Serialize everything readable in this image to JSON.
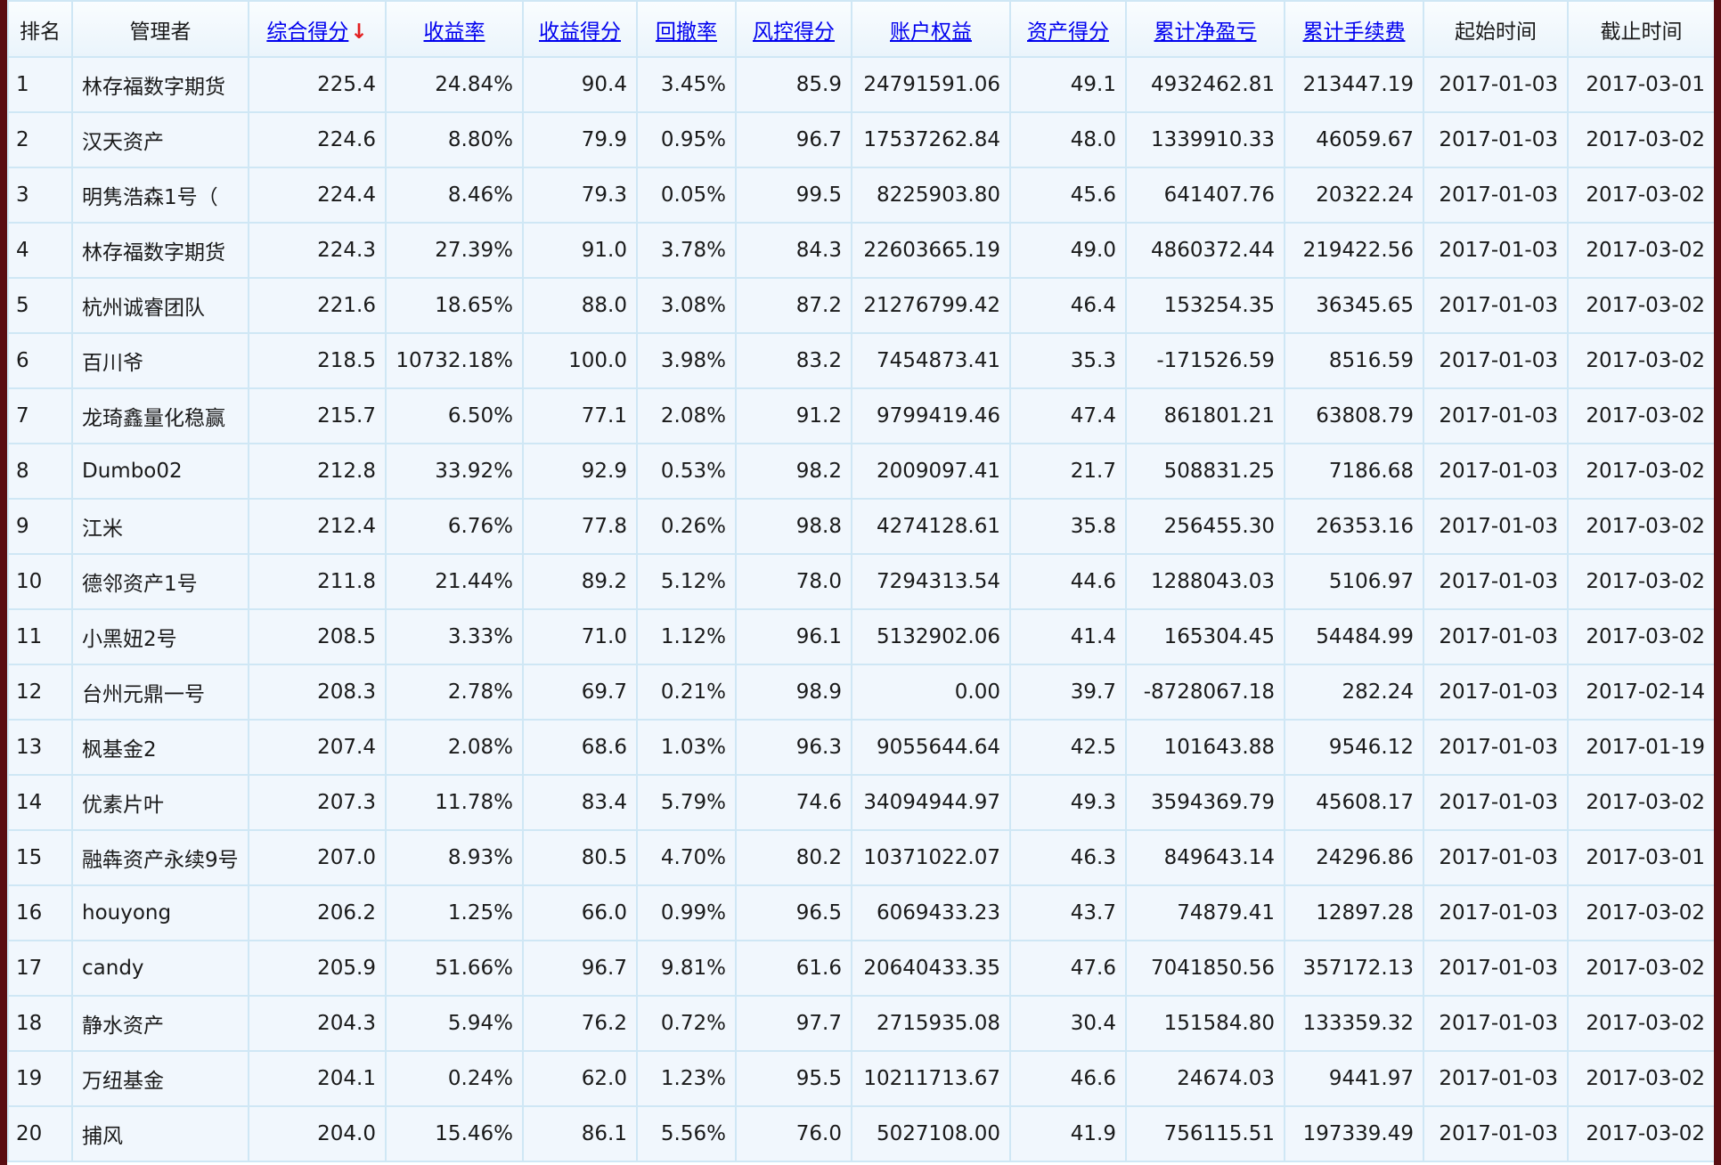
{
  "table": {
    "sort_indicator": "↓",
    "columns": [
      {
        "label": "排名",
        "sortable": false
      },
      {
        "label": "管理者",
        "sortable": false
      },
      {
        "label": "综合得分",
        "sortable": true,
        "sorted": true
      },
      {
        "label": "收益率",
        "sortable": true
      },
      {
        "label": "收益得分",
        "sortable": true
      },
      {
        "label": "回撤率",
        "sortable": true
      },
      {
        "label": "风控得分",
        "sortable": true
      },
      {
        "label": "账户权益",
        "sortable": true
      },
      {
        "label": "资产得分",
        "sortable": true
      },
      {
        "label": "累计净盈亏",
        "sortable": true
      },
      {
        "label": "累计手续费",
        "sortable": true
      },
      {
        "label": "起始时间",
        "sortable": false
      },
      {
        "label": "截止时间",
        "sortable": false
      }
    ],
    "rows": [
      [
        "1",
        "林存福数字期货",
        "225.4",
        "24.84%",
        "90.4",
        "3.45%",
        "85.9",
        "24791591.06",
        "49.1",
        "4932462.81",
        "213447.19",
        "2017-01-03",
        "2017-03-01"
      ],
      [
        "2",
        "汉天资产",
        "224.6",
        "8.80%",
        "79.9",
        "0.95%",
        "96.7",
        "17537262.84",
        "48.0",
        "1339910.33",
        "46059.67",
        "2017-01-03",
        "2017-03-02"
      ],
      [
        "3",
        "明隽浩森1号（",
        "224.4",
        "8.46%",
        "79.3",
        "0.05%",
        "99.5",
        "8225903.80",
        "45.6",
        "641407.76",
        "20322.24",
        "2017-01-03",
        "2017-03-02"
      ],
      [
        "4",
        "林存福数字期货",
        "224.3",
        "27.39%",
        "91.0",
        "3.78%",
        "84.3",
        "22603665.19",
        "49.0",
        "4860372.44",
        "219422.56",
        "2017-01-03",
        "2017-03-02"
      ],
      [
        "5",
        "杭州诚睿团队",
        "221.6",
        "18.65%",
        "88.0",
        "3.08%",
        "87.2",
        "21276799.42",
        "46.4",
        "153254.35",
        "36345.65",
        "2017-01-03",
        "2017-03-02"
      ],
      [
        "6",
        "百川爷",
        "218.5",
        "10732.18%",
        "100.0",
        "3.98%",
        "83.2",
        "7454873.41",
        "35.3",
        "-171526.59",
        "8516.59",
        "2017-01-03",
        "2017-03-02"
      ],
      [
        "7",
        "龙琦鑫量化稳赢",
        "215.7",
        "6.50%",
        "77.1",
        "2.08%",
        "91.2",
        "9799419.46",
        "47.4",
        "861801.21",
        "63808.79",
        "2017-01-03",
        "2017-03-02"
      ],
      [
        "8",
        "Dumbo02",
        "212.8",
        "33.92%",
        "92.9",
        "0.53%",
        "98.2",
        "2009097.41",
        "21.7",
        "508831.25",
        "7186.68",
        "2017-01-03",
        "2017-03-02"
      ],
      [
        "9",
        "江米",
        "212.4",
        "6.76%",
        "77.8",
        "0.26%",
        "98.8",
        "4274128.61",
        "35.8",
        "256455.30",
        "26353.16",
        "2017-01-03",
        "2017-03-02"
      ],
      [
        "10",
        "德邻资产1号",
        "211.8",
        "21.44%",
        "89.2",
        "5.12%",
        "78.0",
        "7294313.54",
        "44.6",
        "1288043.03",
        "5106.97",
        "2017-01-03",
        "2017-03-02"
      ],
      [
        "11",
        "小黑妞2号",
        "208.5",
        "3.33%",
        "71.0",
        "1.12%",
        "96.1",
        "5132902.06",
        "41.4",
        "165304.45",
        "54484.99",
        "2017-01-03",
        "2017-03-02"
      ],
      [
        "12",
        "台州元鼎一号",
        "208.3",
        "2.78%",
        "69.7",
        "0.21%",
        "98.9",
        "0.00",
        "39.7",
        "-8728067.18",
        "282.24",
        "2017-01-03",
        "2017-02-14"
      ],
      [
        "13",
        "枫基金2",
        "207.4",
        "2.08%",
        "68.6",
        "1.03%",
        "96.3",
        "9055644.64",
        "42.5",
        "101643.88",
        "9546.12",
        "2017-01-03",
        "2017-01-19"
      ],
      [
        "14",
        "优素片叶",
        "207.3",
        "11.78%",
        "83.4",
        "5.79%",
        "74.6",
        "34094944.97",
        "49.3",
        "3594369.79",
        "45608.17",
        "2017-01-03",
        "2017-03-02"
      ],
      [
        "15",
        "融犇资产永续9号",
        "207.0",
        "8.93%",
        "80.5",
        "4.70%",
        "80.2",
        "10371022.07",
        "46.3",
        "849643.14",
        "24296.86",
        "2017-01-03",
        "2017-03-01"
      ],
      [
        "16",
        "houyong",
        "206.2",
        "1.25%",
        "66.0",
        "0.99%",
        "96.5",
        "6069433.23",
        "43.7",
        "74879.41",
        "12897.28",
        "2017-01-03",
        "2017-03-02"
      ],
      [
        "17",
        "candy",
        "205.9",
        "51.66%",
        "96.7",
        "9.81%",
        "61.6",
        "20640433.35",
        "47.6",
        "7041850.56",
        "357172.13",
        "2017-01-03",
        "2017-03-02"
      ],
      [
        "18",
        "静水资产",
        "204.3",
        "5.94%",
        "76.2",
        "0.72%",
        "97.7",
        "2715935.08",
        "30.4",
        "151584.80",
        "133359.32",
        "2017-01-03",
        "2017-03-02"
      ],
      [
        "19",
        "万纽基金",
        "204.1",
        "0.24%",
        "62.0",
        "1.23%",
        "95.5",
        "10211713.67",
        "46.6",
        "24674.03",
        "9441.97",
        "2017-01-03",
        "2017-03-02"
      ],
      [
        "20",
        "捕风",
        "204.0",
        "15.46%",
        "86.1",
        "5.56%",
        "76.0",
        "5027108.00",
        "41.9",
        "756115.51",
        "197339.49",
        "2017-01-03",
        "2017-03-02"
      ]
    ]
  },
  "colors": {
    "positive_pnl": "#ee1111",
    "negative_pnl": "#5a9a1a",
    "link": "#0000ee",
    "grid": "#cfe7f5",
    "row_bg": "#f1f7fd",
    "page_border": "#5a0d12"
  }
}
